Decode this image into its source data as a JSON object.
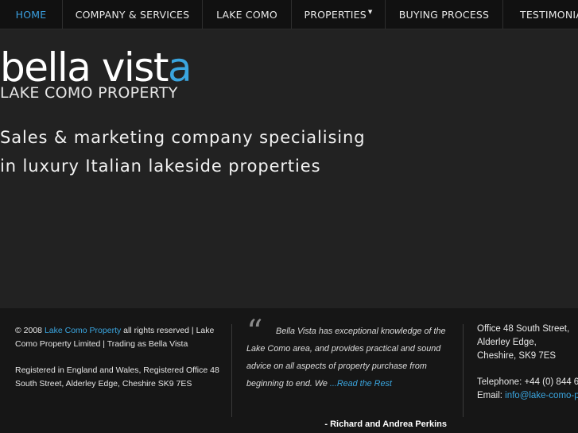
{
  "nav": {
    "items": [
      {
        "label": "HOME",
        "active": true
      },
      {
        "label": "COMPANY & SERVICES",
        "active": false
      },
      {
        "label": "LAKE COMO",
        "active": false
      },
      {
        "label": "PROPERTIES",
        "active": false,
        "dropdown_icon": "caret-down-icon"
      },
      {
        "label": "BUYING PROCESS",
        "active": false
      },
      {
        "label": "TESTIMONIA",
        "active": false
      }
    ]
  },
  "logo": {
    "main": "bella vist",
    "accent": "a",
    "sub": "LAKE COMO PROPERTY"
  },
  "hero": {
    "tagline_line1": "Sales & marketing company specialising",
    "tagline_line2": "in luxury Italian lakeside properties"
  },
  "footer": {
    "copyright_prefix": "© 2008 ",
    "copyright_link": "Lake Como Property",
    "copyright_suffix": " all rights reserved | Lake Como Property Limited | Trading as Bella Vista",
    "registered": "Registered in England and Wales, Registered Office 48 South Street, Alderley Edge, Cheshire SK9 7ES",
    "testimonial": {
      "quote_icon": "quote-icon",
      "text": "Bella Vista has exceptional knowledge of the Lake Como area, and  provides practical and sound advice on all aspects of property purchase from beginning to end. We ",
      "read_more": "...Read the Rest",
      "author": "- Richard and Andrea Perkins"
    },
    "address": {
      "line1": "Office 48 South Street,",
      "line2": "Alderley Edge,",
      "line3": "Cheshire, SK9 7ES",
      "telephone": "Telephone: +44 (0) 844 6",
      "email_label": "Email: ",
      "email": "info@lake-como-pr"
    }
  },
  "colors": {
    "accent": "#3aa5df",
    "nav_bg": "#111111",
    "hero_bg": "#222222",
    "footer_bg": "#161616"
  }
}
